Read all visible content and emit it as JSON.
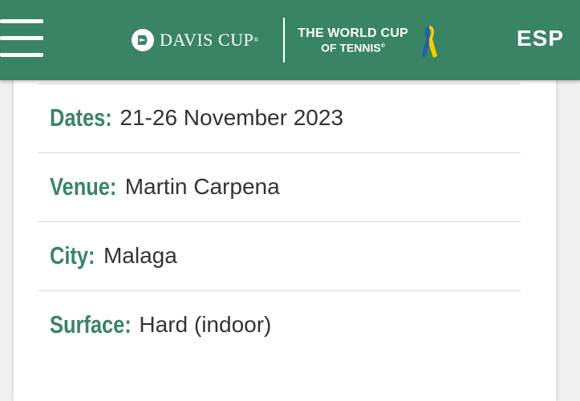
{
  "header": {
    "brand": "DAVIS CUP",
    "tagline_line1": "THE WORLD CUP",
    "tagline_line2": "OF TENNIS",
    "language": "ESP",
    "colors": {
      "primary": "#3a8466",
      "ribbon_blue": "#1f5aa8",
      "ribbon_yellow": "#f5d000"
    },
    "icons": [
      "hamburger-menu-icon",
      "davis-cup-logo-icon",
      "ribbon-icon"
    ]
  },
  "details": [
    {
      "label": "Dates:",
      "value": "21-26 November 2023"
    },
    {
      "label": "Venue:",
      "value": "Martin Carpena"
    },
    {
      "label": "City:",
      "value": "Malaga"
    },
    {
      "label": "Surface:",
      "value": "Hard (indoor)"
    }
  ]
}
